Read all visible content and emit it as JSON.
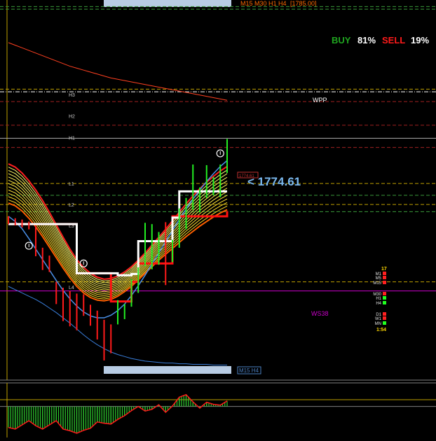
{
  "header": {
    "timeframes_label": "M15 M30 H1 H4",
    "price_tag": "[1785.00]"
  },
  "sentiment": {
    "buy_label": "BUY",
    "buy_pct": "81%",
    "sell_label": "SELL",
    "sell_pct": "19%",
    "buy_color": "#1fa51f",
    "sell_color": "#ff1a1a"
  },
  "pivot_labels": [
    "H3",
    "H2",
    "H1",
    "L1",
    "L2",
    "L3",
    "L4"
  ],
  "wpp_label": "WPP",
  "ws38_label": "WS38",
  "current_price_text": "< 1774.61",
  "mini_price_tag": "1774.61",
  "bottom_box_label": "M15 H4",
  "status_panel": {
    "top_number": "17",
    "rows": [
      {
        "tf": "M1",
        "color": "#ff2020"
      },
      {
        "tf": "M5",
        "color": "#ff2020"
      },
      {
        "tf": "M15",
        "color": "#ff2020"
      },
      {
        "tf": "M30",
        "color": "#ff2020"
      },
      {
        "tf": "H1",
        "color": "#20ff20"
      },
      {
        "tf": "H4",
        "color": "#20ff20"
      },
      {
        "tf": "D1",
        "color": "#ff2020"
      },
      {
        "tf": "W1",
        "color": "#ff2020"
      },
      {
        "tf": "MN",
        "color": "#20ff20"
      }
    ],
    "countdown": "1:54"
  },
  "chart_data": {
    "type": "line",
    "title": "",
    "current_price": 1774.61,
    "ylim": [
      1738,
      1796
    ],
    "grid": false,
    "bar_count": 33,
    "price_bars": [
      {
        "x": 0,
        "high": 1763.0,
        "low": 1761.8,
        "color": "red"
      },
      {
        "x": 1,
        "high": 1762.7,
        "low": 1761.6,
        "color": "red"
      },
      {
        "x": 2,
        "high": 1762.5,
        "low": 1761.3,
        "color": "red"
      },
      {
        "x": 3,
        "high": 1762.2,
        "low": 1761.0,
        "color": "red"
      },
      {
        "x": 4,
        "high": 1761.6,
        "low": 1756.9,
        "color": "red"
      },
      {
        "x": 5,
        "high": 1758.2,
        "low": 1754.8,
        "color": "red"
      },
      {
        "x": 6,
        "high": 1757.0,
        "low": 1754.5,
        "color": "red"
      },
      {
        "x": 7,
        "high": 1753.0,
        "low": 1749.6,
        "color": "red"
      },
      {
        "x": 8,
        "high": 1752.1,
        "low": 1747.0,
        "color": "red"
      },
      {
        "x": 9,
        "high": 1751.6,
        "low": 1746.2,
        "color": "red"
      },
      {
        "x": 10,
        "high": 1751.2,
        "low": 1745.6,
        "color": "red"
      },
      {
        "x": 11,
        "high": 1751.1,
        "low": 1747.8,
        "color": "red"
      },
      {
        "x": 12,
        "high": 1749.5,
        "low": 1746.3,
        "color": "red"
      },
      {
        "x": 13,
        "high": 1748.6,
        "low": 1744.2,
        "color": "red"
      },
      {
        "x": 14,
        "high": 1747.2,
        "low": 1741.0,
        "color": "red"
      },
      {
        "x": 15,
        "high": 1746.5,
        "low": 1742.1,
        "color": "red"
      },
      {
        "x": 16,
        "high": 1750.2,
        "low": 1746.5,
        "color": "green"
      },
      {
        "x": 17,
        "high": 1749.6,
        "low": 1747.3,
        "color": "green"
      },
      {
        "x": 18,
        "high": 1753.4,
        "low": 1749.2,
        "color": "green"
      },
      {
        "x": 19,
        "high": 1755.2,
        "low": 1751.3,
        "color": "green"
      },
      {
        "x": 20,
        "high": 1762.0,
        "low": 1755.4,
        "color": "green"
      },
      {
        "x": 21,
        "high": 1761.8,
        "low": 1754.9,
        "color": "green"
      },
      {
        "x": 22,
        "high": 1760.6,
        "low": 1755.6,
        "color": "green"
      },
      {
        "x": 23,
        "high": 1762.1,
        "low": 1752.5,
        "color": "red"
      },
      {
        "x": 24,
        "high": 1759.4,
        "low": 1756.0,
        "color": "green"
      },
      {
        "x": 25,
        "high": 1764.2,
        "low": 1758.2,
        "color": "green"
      },
      {
        "x": 26,
        "high": 1765.8,
        "low": 1761.0,
        "color": "green"
      },
      {
        "x": 27,
        "high": 1770.9,
        "low": 1764.0,
        "color": "green"
      },
      {
        "x": 28,
        "high": 1767.4,
        "low": 1763.6,
        "color": "green"
      },
      {
        "x": 29,
        "high": 1770.8,
        "low": 1765.8,
        "color": "green"
      },
      {
        "x": 30,
        "high": 1769.0,
        "low": 1766.2,
        "color": "green"
      },
      {
        "x": 31,
        "high": 1770.9,
        "low": 1765.9,
        "color": "green"
      },
      {
        "x": 32,
        "high": 1774.8,
        "low": 1769.6,
        "color": "green"
      }
    ],
    "white_trend_line": [
      1761.8,
      1761.8,
      1761.8,
      1761.8,
      1761.8,
      1761.8,
      1761.8,
      1761.8,
      1761.8,
      1761.8,
      1754.3,
      1754.3,
      1754.3,
      1754.3,
      1754.3,
      1754.3,
      1754.0,
      1754.0,
      1754.2,
      1759.2,
      1759.2,
      1759.2,
      1759.2,
      1759.2,
      1762.8,
      1766.8,
      1766.8,
      1766.8,
      1766.8,
      1766.8,
      1766.8,
      1766.8,
      1766.8
    ],
    "red_trend_line": [
      1761.8,
      1761.8,
      1761.8,
      1761.8,
      1761.8,
      1761.8,
      1761.8,
      1761.8,
      1761.8,
      1761.8,
      1754.3,
      1754.3,
      1754.3,
      1754.3,
      1754.3,
      1750.0,
      1750.0,
      1750.0,
      1753.0,
      1755.8,
      1755.8,
      1755.8,
      1755.8,
      1755.8,
      1763.0,
      1763.0,
      1763.0,
      1763.0,
      1763.0,
      1763.0,
      1763.0,
      1763.0,
      1763.8
    ],
    "ribbon_upper": [
      1771.0,
      1770.5,
      1769.6,
      1768.4,
      1767.0,
      1765.4,
      1763.6,
      1761.7,
      1759.8,
      1758.0,
      1756.4,
      1755.2,
      1754.3,
      1753.7,
      1753.4,
      1753.5,
      1753.9,
      1754.5,
      1755.3,
      1756.3,
      1757.4,
      1758.6,
      1759.8,
      1761.0,
      1762.3,
      1763.6,
      1764.9,
      1766.1,
      1767.2,
      1768.2,
      1769.1,
      1769.9,
      1770.6
    ],
    "ribbon_lower": [
      1765.0,
      1764.6,
      1763.8,
      1762.7,
      1761.4,
      1759.9,
      1758.3,
      1756.7,
      1755.1,
      1753.6,
      1752.3,
      1751.3,
      1750.6,
      1750.2,
      1750.1,
      1750.3,
      1750.8,
      1751.5,
      1752.3,
      1753.3,
      1754.3,
      1755.3,
      1756.3,
      1757.2,
      1758.1,
      1759.0,
      1759.9,
      1760.7,
      1761.5,
      1762.2,
      1762.9,
      1763.5,
      1764.0
    ],
    "blue_lower_line": [
      1752.3,
      1751.8,
      1751.3,
      1750.8,
      1750.3,
      1749.7,
      1749.0,
      1748.3,
      1747.5,
      1746.7,
      1745.8,
      1744.9,
      1744.1,
      1743.4,
      1742.8,
      1742.3,
      1741.9,
      1741.6,
      1741.3,
      1741.1,
      1740.9,
      1740.8,
      1740.7,
      1740.6,
      1740.6,
      1740.5,
      1740.5,
      1740.4,
      1740.4,
      1740.4,
      1740.3,
      1740.3,
      1740.3
    ],
    "blue_inner_line": [
      1763.0,
      1762.2,
      1761.1,
      1759.6,
      1758.0,
      1756.4,
      1754.8,
      1753.2,
      1751.7,
      1750.4,
      1749.3,
      1748.4,
      1747.8,
      1747.5,
      1747.5,
      1747.9,
      1748.6,
      1749.6,
      1750.9,
      1752.4,
      1754.0,
      1755.7,
      1757.4,
      1759.1,
      1760.8,
      1762.5,
      1764.1,
      1765.6,
      1767.0,
      1768.3,
      1769.5,
      1770.6,
      1771.5
    ],
    "red_declining_line": [
      1789.5,
      1789.1,
      1788.7,
      1788.3,
      1787.9,
      1787.5,
      1787.1,
      1786.7,
      1786.3,
      1785.9,
      1785.6,
      1785.3,
      1785.0,
      1784.7,
      1784.4,
      1784.1,
      1783.9,
      1783.7,
      1783.5,
      1783.3,
      1783.1,
      1782.9,
      1782.7,
      1782.5,
      1782.3,
      1782.1,
      1781.9,
      1781.7,
      1781.5,
      1781.3,
      1781.1,
      1780.9,
      1780.7
    ],
    "horizontal_levels": [
      {
        "price": 1795.0,
        "color": "#3a9a3a",
        "style": "dash"
      },
      {
        "price": 1794.6,
        "color": "#3a9a3a",
        "style": "dash"
      },
      {
        "price": 1782.4,
        "color": "#c0a000",
        "style": "dash"
      },
      {
        "price": 1782.0,
        "color": "#ffffff",
        "style": "dashdot"
      },
      {
        "price": 1780.5,
        "color": "#a02020",
        "style": "dash"
      },
      {
        "price": 1776.9,
        "color": "#a02020",
        "style": "dash"
      },
      {
        "price": 1773.5,
        "color": "#a02020",
        "style": "dash"
      },
      {
        "price": 1768.0,
        "color": "#c0a000",
        "style": "dash"
      },
      {
        "price": 1766.2,
        "color": "#3a9a3a",
        "style": "dash"
      },
      {
        "price": 1764.8,
        "color": "#c0a000",
        "style": "dash"
      },
      {
        "price": 1763.7,
        "color": "#3a9a3a",
        "style": "dash"
      },
      {
        "price": 1753.0,
        "color": "#c0a000",
        "style": "dash"
      },
      {
        "price": 1751.6,
        "color": "#cc00cc",
        "style": "solid"
      },
      {
        "price": 1774.9,
        "color": "#a8a8a8",
        "style": "solid"
      }
    ],
    "pivot_label_prices": [
      1781.6,
      1778.3,
      1775.0,
      1768.0,
      1764.8,
      1761.6,
      1752.2
    ],
    "signal_markers": [
      {
        "x": 3,
        "price": 1758.5,
        "direction": "down"
      },
      {
        "x": 11,
        "price": 1755.8,
        "direction": "down"
      },
      {
        "x": 31,
        "price": 1772.6,
        "direction": "down"
      }
    ],
    "oscillator": [
      -6.6,
      -7.0,
      -6.0,
      -5.0,
      -6.2,
      -7.0,
      -6.0,
      -5.0,
      -7.0,
      -7.4,
      -8.0,
      -7.3,
      -6.8,
      -5.3,
      -5.6,
      -5.8,
      -4.7,
      -3.8,
      -2.6,
      -1.6,
      -2.7,
      -2.3,
      -1.2,
      -3.0,
      -1.5,
      0.6,
      1.2,
      -0.5,
      -2.0,
      -0.6,
      -1.1,
      -1.3,
      -0.3
    ]
  }
}
